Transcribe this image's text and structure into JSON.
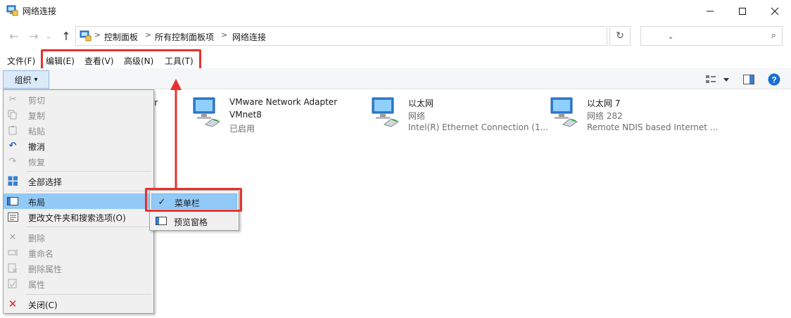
{
  "window": {
    "title": "网络连接"
  },
  "nav": {
    "back": "←",
    "forward": "→",
    "recent": "⌄",
    "up": "↑"
  },
  "address": {
    "crumbs": [
      "控制面板",
      "所有控制面板项",
      "网络连接"
    ],
    "separator": ">",
    "dropdown": "⌄",
    "refresh": "↻"
  },
  "search": {
    "placeholder": "",
    "icon": "⌕"
  },
  "menubar": {
    "file": "文件(F)",
    "edit": "编辑(E)",
    "view": "查看(V)",
    "advanced": "高级(N)",
    "tools": "工具(T)"
  },
  "toolbar": {
    "organize": "组织",
    "organize_arrow": "▾",
    "help": "?"
  },
  "connections": [
    {
      "name": "VMware Network Adapter",
      "line2": "VMnet8",
      "line3": "已启用"
    },
    {
      "name": "以太网",
      "line2": "网络",
      "line3": "Intel(R) Ethernet Connection (1..."
    },
    {
      "name": "以太网 7",
      "line2": "网络 282",
      "line3": "Remote NDIS based Internet ..."
    }
  ],
  "partial_item_text": "er",
  "organize_menu": {
    "cut": "剪切",
    "copy": "复制",
    "paste": "粘贴",
    "undo": "撤消",
    "redo": "恢复",
    "select_all": "全部选择",
    "layout": "布局",
    "folder_options": "更改文件夹和搜索选项(O)",
    "delete": "删除",
    "rename": "重命名",
    "remove_properties": "删除属性",
    "properties": "属性",
    "close": "关闭(C)"
  },
  "layout_submenu": {
    "menu_bar": "菜单栏",
    "menu_bar_checked": "✓",
    "preview_pane": "预览窗格"
  },
  "colors": {
    "highlight": "#91c9f7",
    "annotation_red": "#e8312f",
    "help_blue": "#1a6fd1"
  }
}
